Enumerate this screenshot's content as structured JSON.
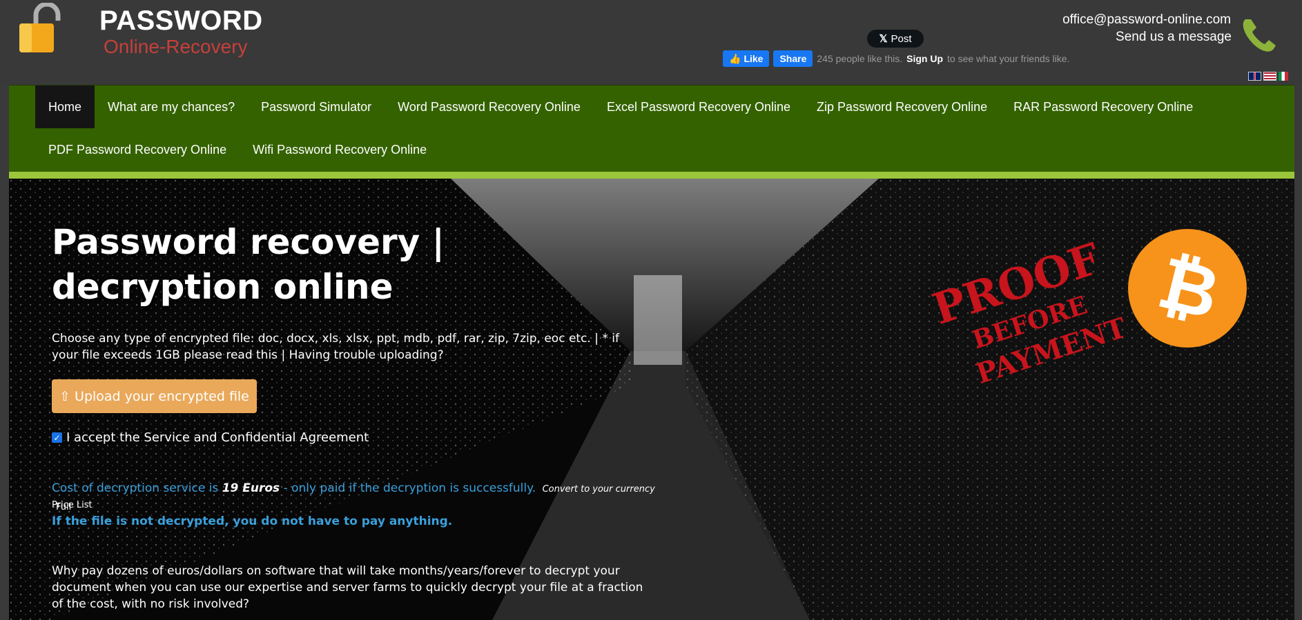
{
  "header": {
    "logo_title": "PASSWORD",
    "logo_subtitle": "Online-Recovery",
    "x_post_label": "Post",
    "fb_like_label": "Like",
    "fb_share_label": "Share",
    "fb_count_text": "245 people like this.",
    "fb_signup_label": "Sign Up",
    "fb_tail_text": "to see what your friends like.",
    "email": "office@password-online.com",
    "message_link": "Send us a message",
    "icons": [
      "padlock-icon",
      "phone-icon",
      "x-logo-icon",
      "thumbs-up-icon"
    ]
  },
  "flags": [
    "uk-flag",
    "us-flag",
    "italy-flag"
  ],
  "nav": {
    "row1": [
      "Home",
      "What are my chances?",
      "Password Simulator",
      "Word Password Recovery Online",
      "Excel Password Recovery Online",
      "Zip Password Recovery Online",
      "RAR Password Recovery Online"
    ],
    "row2": [
      "PDF Password Recovery Online",
      "Wifi Password Recovery Online"
    ],
    "active": "Home"
  },
  "hero": {
    "title": "Password recovery | decryption online",
    "desc_main": "Choose any type of encrypted file: doc, docx, xls, xlsx, ppt, mdb, pdf, rar, zip, 7zip, eoc etc.",
    "desc_sep1": " | ",
    "desc_link1": "* if your file exceeds 1GB please read this",
    "desc_sep2": " | ",
    "desc_link2": "Having trouble uploading?",
    "upload_label": "Upload your encrypted file",
    "agree_label": "I accept the Service and Confidential Agreement",
    "agree_checked": true,
    "cost_prefix": "Cost of decryption service is",
    "cost_price": "19 Euros",
    "cost_suffix": "- only paid if the decryption is successfully.",
    "convert_link": "Convert to your currency",
    "full_label": "Full",
    "pricelist_label": "Price List",
    "nopay_text": "If the file is not decrypted, you do not have to pay anything.",
    "why_text": "Why pay dozens of euros/dollars on software that will take months/years/forever to decrypt your document when you can use our expertise and server farms to quickly decrypt your file at a fraction of the cost, with no risk involved?",
    "stamp_line1": "PROOF",
    "stamp_line2": "BEFORE",
    "stamp_line3": "PAYMENT",
    "bitcoin_symbol": "₿"
  },
  "colors": {
    "nav_bg": "#346200",
    "nav_accent": "#9bc63a",
    "upload_btn": "#e9a85a",
    "link_blue": "#3aa0dc",
    "logo_red": "#c6403a",
    "bitcoin_orange": "#f7931a"
  }
}
